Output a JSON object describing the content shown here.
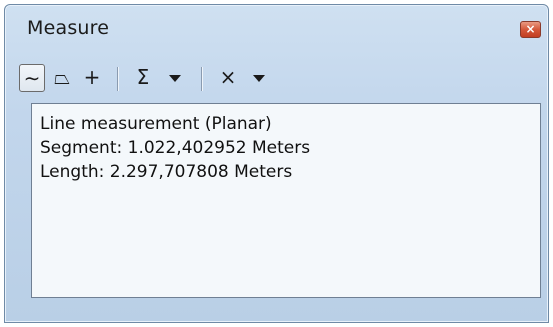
{
  "window": {
    "title": "Measure",
    "close_label": "×"
  },
  "toolbar": {
    "items": [
      {
        "name": "measure-line-tool",
        "icon": "line-icon",
        "glyph": "∼",
        "active": true
      },
      {
        "name": "measure-area-tool",
        "icon": "area-icon",
        "glyph": "⏢",
        "active": false
      },
      {
        "name": "measure-feature-tool",
        "icon": "feature-plus-icon",
        "glyph": "+",
        "active": false
      },
      {
        "name": "show-total-tool",
        "icon": "sum-icon",
        "glyph": "Σ",
        "active": false
      },
      {
        "name": "clear-tool",
        "icon": "clear-icon",
        "glyph": "×",
        "active": false
      }
    ]
  },
  "results": {
    "lines": [
      "Line measurement (Planar)",
      "Segment: 1.022,402952 Meters",
      "Length: 2.297,707808 Meters"
    ]
  },
  "colors": {
    "frame": "#c2d6ec",
    "close": "#c23e22",
    "content_bg": "#f4f8fb"
  }
}
